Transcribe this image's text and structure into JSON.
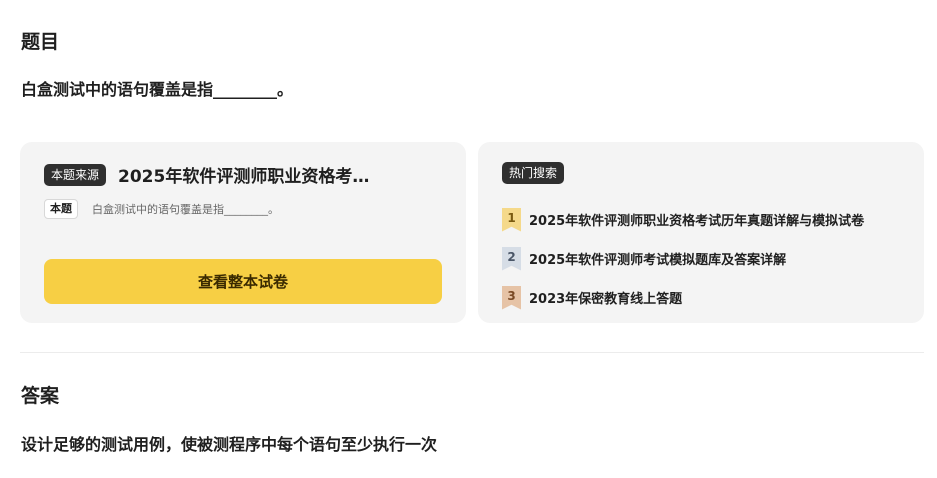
{
  "question": {
    "heading": "题目",
    "text": "白盒测试中的语句覆盖是指________。"
  },
  "source_card": {
    "tag": "本题来源",
    "title": "2025年软件评测师职业资格考…",
    "snippet_tag": "本题",
    "snippet": "白盒测试中的语句覆盖是指________。",
    "button_label": "查看整本试卷",
    "button_color": "#f7cf44"
  },
  "hot_search": {
    "tag": "热门搜索",
    "items": [
      {
        "rank": "1",
        "label": "2025年软件评测师职业资格考试历年真题详解与模拟试卷"
      },
      {
        "rank": "2",
        "label": "2025年软件评测师考试模拟题库及答案详解"
      },
      {
        "rank": "3",
        "label": "2023年保密教育线上答题"
      }
    ]
  },
  "answer": {
    "heading": "答案",
    "text": "设计足够的测试用例，使被测程序中每个语句至少执行一次"
  }
}
